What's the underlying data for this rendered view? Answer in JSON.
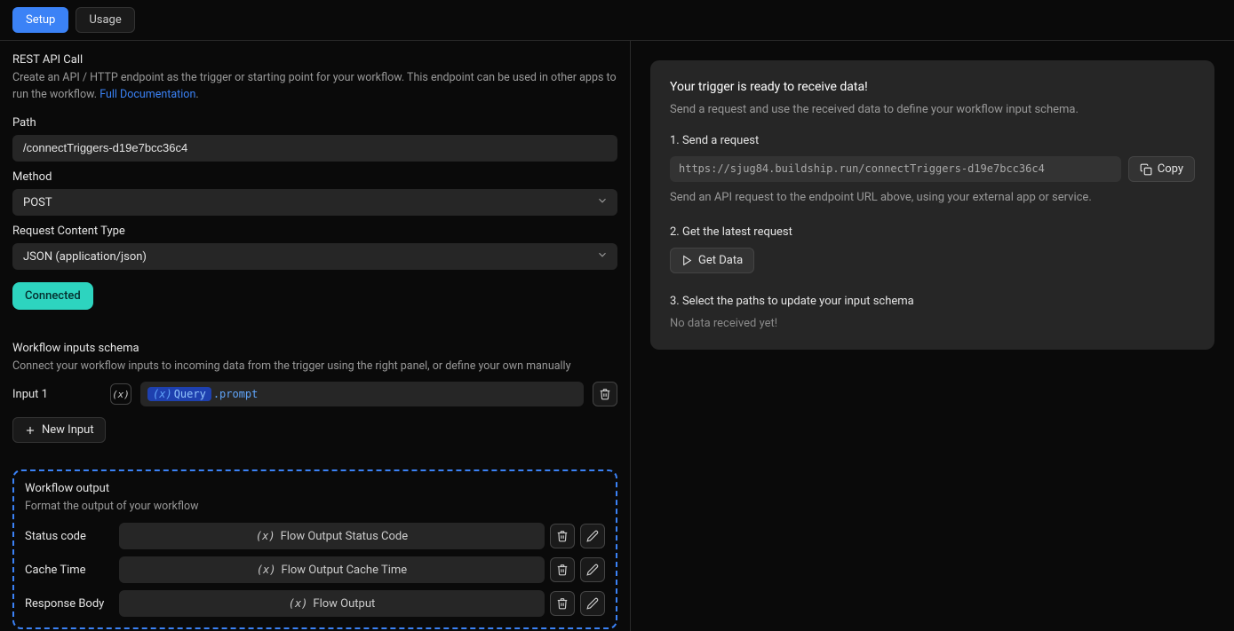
{
  "tabs": {
    "setup": "Setup",
    "usage": "Usage"
  },
  "left": {
    "title": "REST API Call",
    "desc": "Create an API / HTTP endpoint as the trigger or starting point for your workflow. This endpoint can be used in other apps to run the workflow. ",
    "doc_link": "Full Documentation",
    "doc_period": ".",
    "path_label": "Path",
    "path_value": "/connectTriggers-d19e7bcc36c4",
    "method_label": "Method",
    "method_value": "POST",
    "content_label": "Request Content Type",
    "content_value": "JSON (application/json)",
    "connected": "Connected",
    "schema_title": "Workflow inputs schema",
    "schema_desc": "Connect your workflow inputs to incoming data from the trigger using the right panel, or define your own manually",
    "input1_label": "Input 1",
    "input1_token": "Query",
    "input1_suffix": ".prompt",
    "new_input": "New Input",
    "output_title": "Workflow output",
    "output_desc": "Format the output of your workflow",
    "outputs": [
      {
        "label": "Status code",
        "value": "Flow Output Status Code"
      },
      {
        "label": "Cache Time",
        "value": "Flow Output Cache Time"
      },
      {
        "label": "Response Body",
        "value": "Flow Output"
      }
    ]
  },
  "right": {
    "title": "Your trigger is ready to receive data!",
    "desc": "Send a request and use the received data to define your workflow input schema.",
    "step1": "1. Send a request",
    "url": "https://sjug84.buildship.run/connectTriggers-d19e7bcc36c4",
    "copy": "Copy",
    "step1_note": "Send an API request to the endpoint URL above, using your external app or service.",
    "step2": "2. Get the latest request",
    "get_data": "Get Data",
    "step3": "3. Select the paths to update your input schema",
    "no_data": "No data received yet!"
  }
}
